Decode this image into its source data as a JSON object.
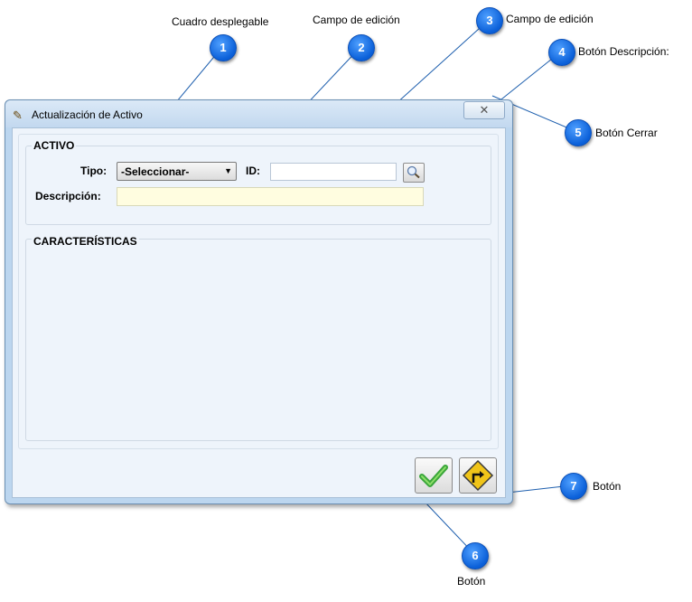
{
  "callouts": [
    {
      "number": "1",
      "label": "Cuadro desplegable"
    },
    {
      "number": "2",
      "label": "Campo de edición"
    },
    {
      "number": "3",
      "label": "Campo de edición"
    },
    {
      "number": "4",
      "label": "Botón Descripción:"
    },
    {
      "number": "5",
      "label": "Botón Cerrar"
    },
    {
      "number": "6",
      "label": "Botón"
    },
    {
      "number": "7",
      "label": "Botón"
    }
  ],
  "window": {
    "title": "Actualización de Activo",
    "close_glyph": "✕"
  },
  "activo": {
    "group_title": "ACTIVO",
    "tipo_label": "Tipo:",
    "tipo_selected": "-Seleccionar-",
    "id_label": "ID:",
    "id_value": "",
    "descripcion_label": "Descripción:",
    "descripcion_value": ""
  },
  "caracteristicas": {
    "group_title": "CARACTERÍSTICAS"
  },
  "colors": {
    "badge": "#1a74e8",
    "description_field": "#fffde0",
    "accept_check": "#3aa63a",
    "return_sign": "#f0c419"
  },
  "icons": {
    "title": "pencil-icon",
    "search": "magnifier-icon",
    "accept": "checkmark-icon",
    "return": "turn-right-sign-icon"
  }
}
